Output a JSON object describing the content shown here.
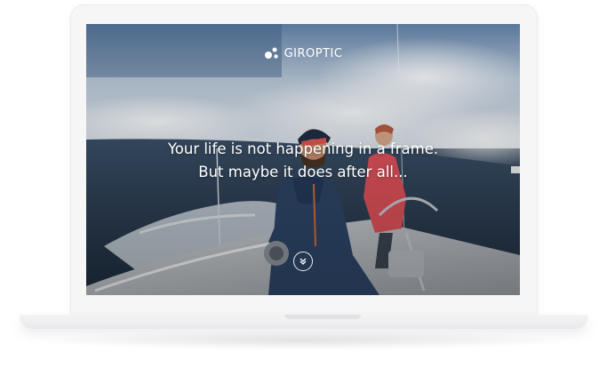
{
  "brand": {
    "name": "GIROPTIC",
    "logo_icon": "giroptic-dots-logo-icon"
  },
  "hero": {
    "headline_line1": "Your life is not happening in a frame.",
    "headline_line2": "But maybe it does after all..."
  },
  "scroll_button": {
    "icon": "double-chevron-down-icon"
  },
  "colors": {
    "text": "#ffffff",
    "device_frame": "#f6f6f7",
    "sea": "#2b3f55",
    "sky": "#b9c8d8",
    "jacket_blue": "#2e4668",
    "jacket_red": "#e0525a"
  }
}
